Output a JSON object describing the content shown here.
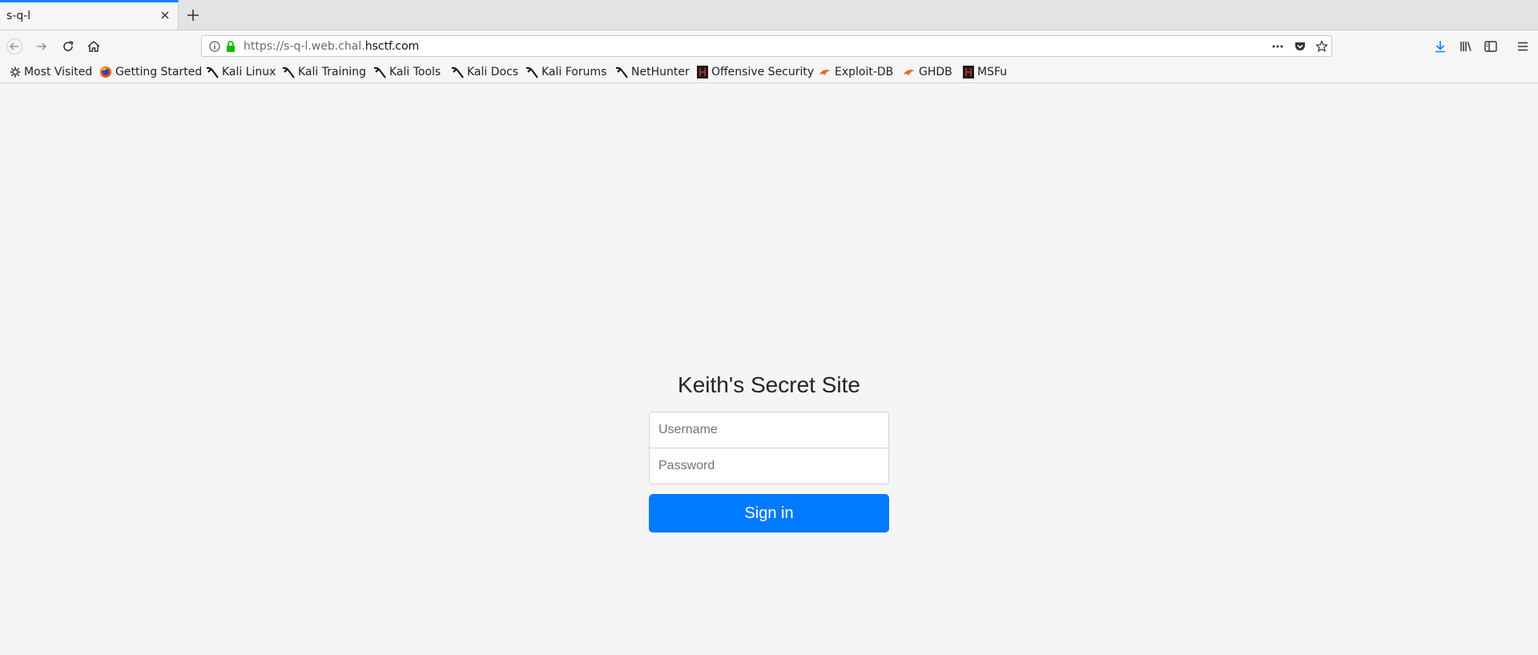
{
  "tab": {
    "title": "s-q-l"
  },
  "urlbar": {
    "prefix": "https://s-q-l.web.chal.",
    "domain": "hsctf.com"
  },
  "bookmarks": [
    {
      "label": "Most Visited",
      "icon": "gear-icon"
    },
    {
      "label": "Getting Started",
      "icon": "firefox-icon"
    },
    {
      "label": "Kali Linux",
      "icon": "kali-icon"
    },
    {
      "label": "Kali Training",
      "icon": "kali-icon"
    },
    {
      "label": "Kali Tools",
      "icon": "kali-icon"
    },
    {
      "label": "Kali Docs",
      "icon": "kali-icon"
    },
    {
      "label": "Kali Forums",
      "icon": "kali-icon"
    },
    {
      "label": "NetHunter",
      "icon": "kali-icon"
    },
    {
      "label": "Offensive Security",
      "icon": "offsec-icon"
    },
    {
      "label": "Exploit-DB",
      "icon": "exploitdb-icon"
    },
    {
      "label": "GHDB",
      "icon": "exploitdb-icon"
    },
    {
      "label": "MSFu",
      "icon": "offsec-icon"
    }
  ],
  "login": {
    "title": "Keith's Secret Site",
    "username_placeholder": "Username",
    "password_placeholder": "Password",
    "signin_label": "Sign in"
  },
  "colors": {
    "accent": "#0a84ff",
    "button": "#007bff",
    "page_background": "#f5f5f5"
  }
}
